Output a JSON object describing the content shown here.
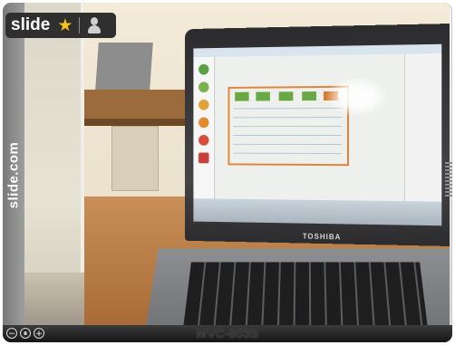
{
  "logo": {
    "wordmark": "slide",
    "star_icon": "star-icon",
    "user_icon": "user-icon"
  },
  "rail": {
    "text": "slide.com"
  },
  "photo": {
    "laptop_brand": "TOSHIBA",
    "caption": "MVC-803S"
  },
  "controls": {
    "minus_icon": "−",
    "pause_icon": "⏸",
    "plus_icon": "+"
  },
  "colors": {
    "star": "#f7c21b",
    "bar": "#1a1a1a",
    "frame": "#dcdcdc"
  }
}
